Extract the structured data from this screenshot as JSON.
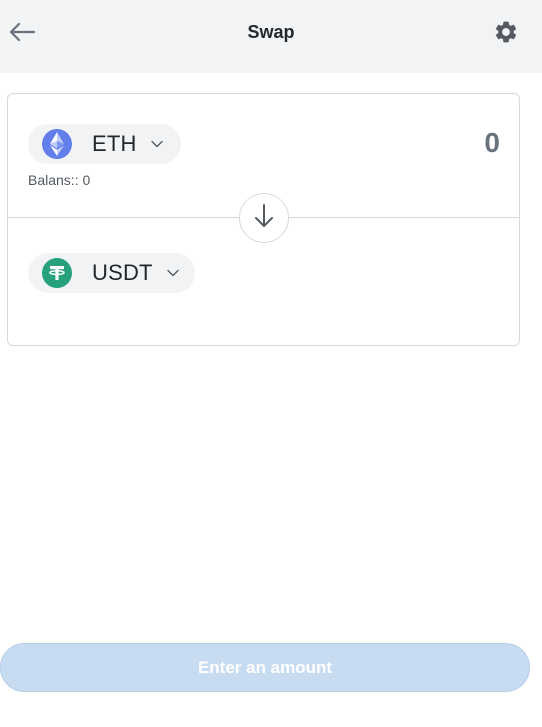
{
  "header": {
    "title": "Swap",
    "back_icon": "arrow-left-icon",
    "settings_icon": "gear-icon"
  },
  "swap": {
    "from": {
      "symbol": "ETH",
      "icon": "ethereum-icon",
      "amount": "0",
      "balance": "Balans:: 0"
    },
    "to": {
      "symbol": "USDT",
      "icon": "tether-icon"
    },
    "switch_icon": "arrow-down-icon"
  },
  "cta": {
    "label": "Enter an amount",
    "enabled": false
  },
  "colors": {
    "header_bg": "#f2f3f4",
    "eth": "#627eea",
    "usdt": "#26a17b",
    "cta_disabled": "#c7dbf1"
  }
}
